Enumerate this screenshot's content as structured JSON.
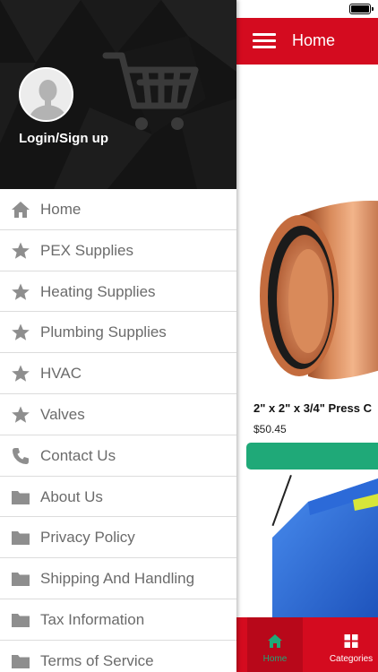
{
  "app": {
    "title": "Home",
    "product": {
      "name": "2\" x 2\" x 3/4\" Press C",
      "price": "$50.45"
    },
    "bottom_nav": [
      {
        "label": "Home",
        "icon": "home-icon",
        "active": true
      },
      {
        "label": "Categories",
        "icon": "grid-icon",
        "active": false
      }
    ],
    "colors": {
      "primary": "#d40b1f",
      "accent": "#1fa978",
      "drawer_header": "#111111"
    }
  },
  "drawer": {
    "login_label": "Login/Sign up",
    "items": [
      {
        "label": "Home",
        "icon": "home-icon"
      },
      {
        "label": "PEX Supplies",
        "icon": "star-icon"
      },
      {
        "label": "Heating Supplies",
        "icon": "star-icon"
      },
      {
        "label": "Plumbing Supplies",
        "icon": "star-icon"
      },
      {
        "label": "HVAC",
        "icon": "star-icon"
      },
      {
        "label": "Valves",
        "icon": "star-icon"
      },
      {
        "label": "Contact Us",
        "icon": "phone-icon"
      },
      {
        "label": "About Us",
        "icon": "folder-icon"
      },
      {
        "label": "Privacy Policy",
        "icon": "folder-icon"
      },
      {
        "label": "Shipping And Handling",
        "icon": "folder-icon"
      },
      {
        "label": "Tax Information",
        "icon": "folder-icon"
      },
      {
        "label": "Terms of Service",
        "icon": "folder-icon"
      }
    ]
  }
}
